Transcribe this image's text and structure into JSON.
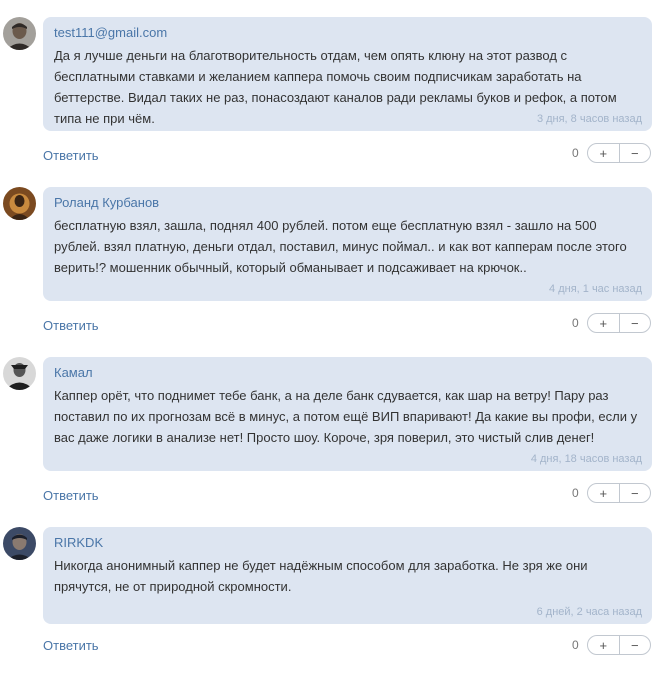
{
  "comments": [
    {
      "author": "test111@gmail.com",
      "text": "Да я лучше деньги на благотворительность отдам, чем опять клюну на этот развод с бесплатными ставками и желанием каппера помочь своим подписчикам заработать на беттерстве. Видал таких не раз, понасоздают каналов ради рекламы буков и рефок, а потом типа не при чём.",
      "date": "3 дня, 8 часов назад",
      "reply_label": "Ответить",
      "score": "0",
      "plus_label": "+",
      "minus_label": "−",
      "avatar_icon": "user-photo-icon",
      "avatar_colors": [
        "#a3a09b",
        "#6b5a4c",
        "#2f2a27"
      ]
    },
    {
      "author": "Роланд Курбанов",
      "text": "бесплатную взял, зашла, поднял 400 рублей. потом еще бесплатную взял - зашло на 500 рублей. взял платную, деньги отдал, поставил, минус поймал.. и как вот капперам после этого верить!? мошенник обычный, который обманывает и подсаживает на крючок..",
      "date": "4 дня, 1 час назад",
      "reply_label": "Ответить",
      "score": "0",
      "plus_label": "+",
      "minus_label": "−",
      "avatar_icon": "user-photo-icon",
      "avatar_colors": [
        "#7b4a20",
        "#c98a3e",
        "#3a2414"
      ]
    },
    {
      "author": "Камал",
      "text": "Каппер орёт, что поднимет тебе банк, а на деле банк сдувается, как шар на ветру! Пару раз поставил по их прогнозам всё в минус, а потом ещё ВИП впаривают! Да какие вы профи, если у вас даже логики в анализе нет! Просто шоу. Короче, зря поверил, это чистый слив денег!",
      "date": "4 дня, 18 часов назад",
      "reply_label": "Ответить",
      "score": "0",
      "plus_label": "+",
      "minus_label": "−",
      "avatar_icon": "user-photo-icon",
      "avatar_colors": [
        "#d8d8d8",
        "#555555",
        "#1e1e1e"
      ]
    },
    {
      "author": "RIRKDK",
      "text": "Никогда анонимный каппер не будет надёжным способом для заработка. Не зря же они прячутся, не от природной скромности.",
      "date": "6 дней, 2 часа назад",
      "reply_label": "Ответить",
      "score": "0",
      "plus_label": "+",
      "minus_label": "−",
      "avatar_icon": "user-photo-icon",
      "avatar_colors": [
        "#3c4a66",
        "#8a7a70",
        "#1b1f2a"
      ]
    }
  ]
}
